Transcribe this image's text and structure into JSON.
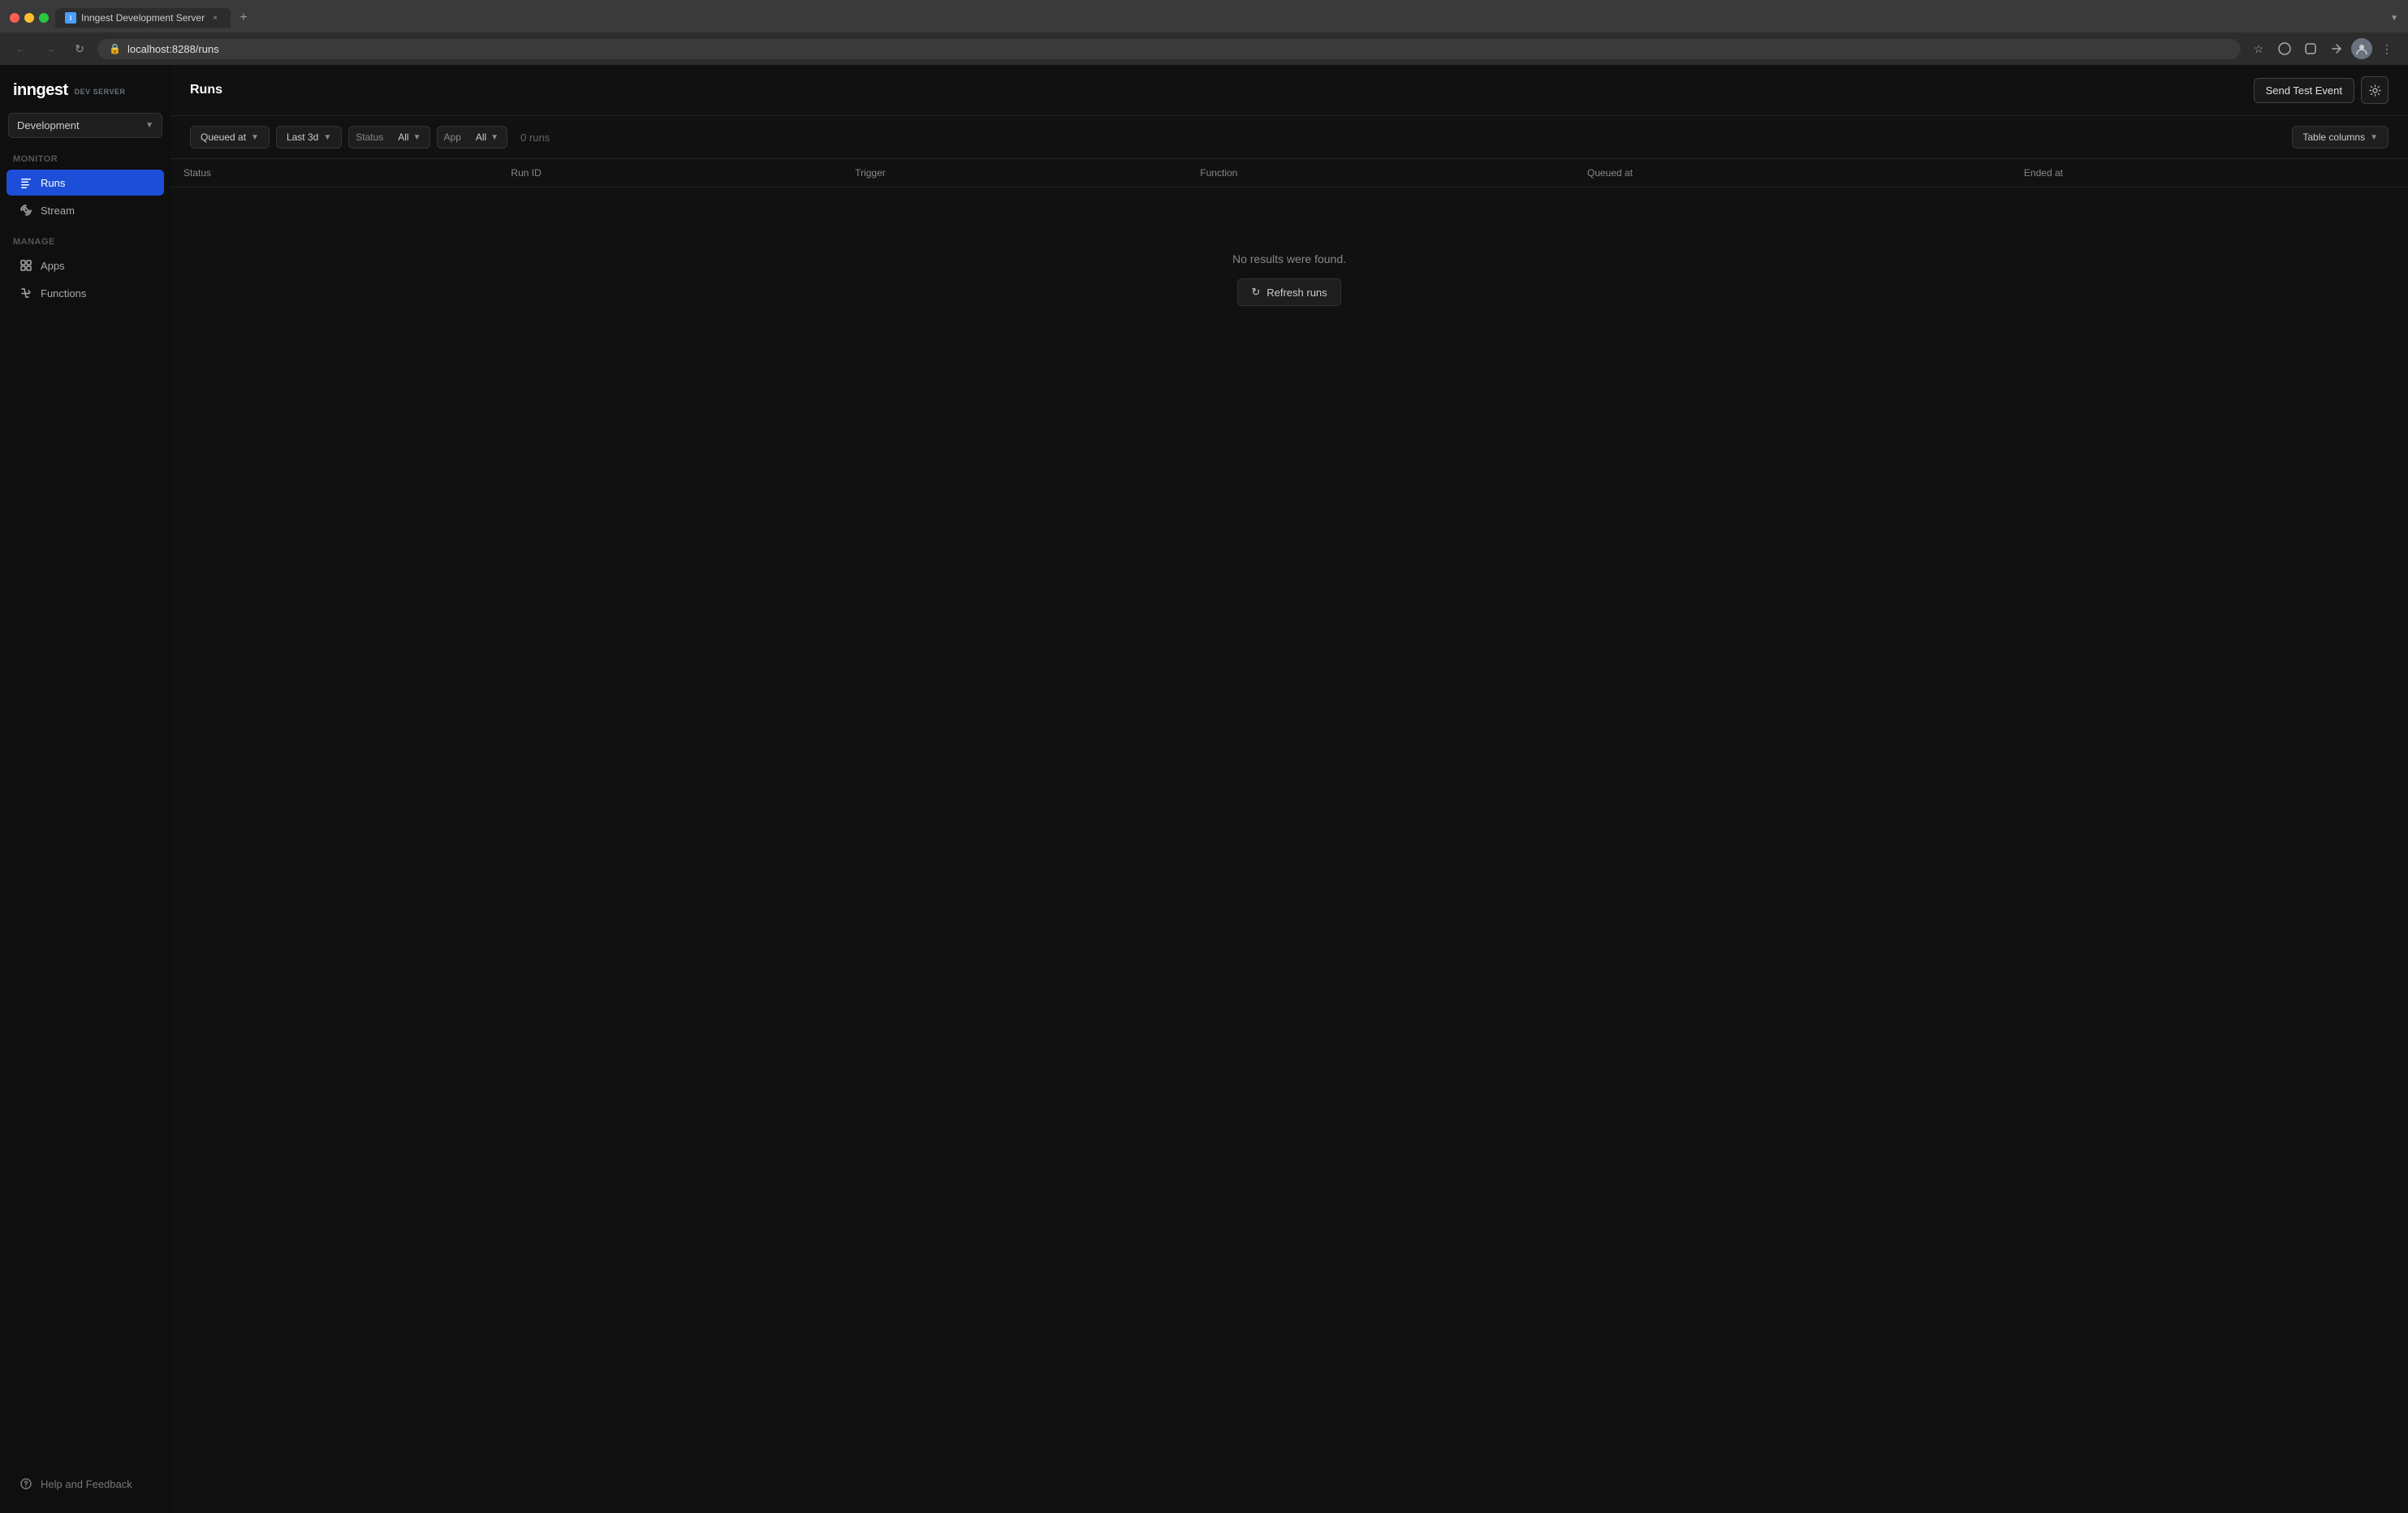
{
  "browser": {
    "tab_title": "Inngest Development Server",
    "url": "localhost:8288/runs",
    "new_tab_label": "+"
  },
  "sidebar": {
    "logo": "inngest",
    "logo_badge": "DEV SERVER",
    "environment": "Development",
    "monitor_label": "Monitor",
    "manage_label": "Manage",
    "nav_items": [
      {
        "id": "runs",
        "label": "Runs",
        "active": true
      },
      {
        "id": "stream",
        "label": "Stream",
        "active": false
      },
      {
        "id": "apps",
        "label": "Apps",
        "active": false
      },
      {
        "id": "functions",
        "label": "Functions",
        "active": false
      }
    ],
    "help_label": "Help and Feedback"
  },
  "header": {
    "title": "Runs",
    "send_test_btn": "Send Test Event",
    "settings_btn_aria": "Settings"
  },
  "filters": {
    "queued_at_label": "Queued at",
    "queued_at_value": "Last 3d",
    "status_label": "Status",
    "status_value": "All",
    "app_label": "App",
    "app_value": "All",
    "run_count": "0 runs",
    "table_columns_btn": "Table columns"
  },
  "table": {
    "columns": [
      "Status",
      "Run ID",
      "Trigger",
      "Function",
      "Queued at",
      "Ended at"
    ]
  },
  "empty_state": {
    "message": "No results were found.",
    "refresh_btn": "Refresh runs"
  }
}
